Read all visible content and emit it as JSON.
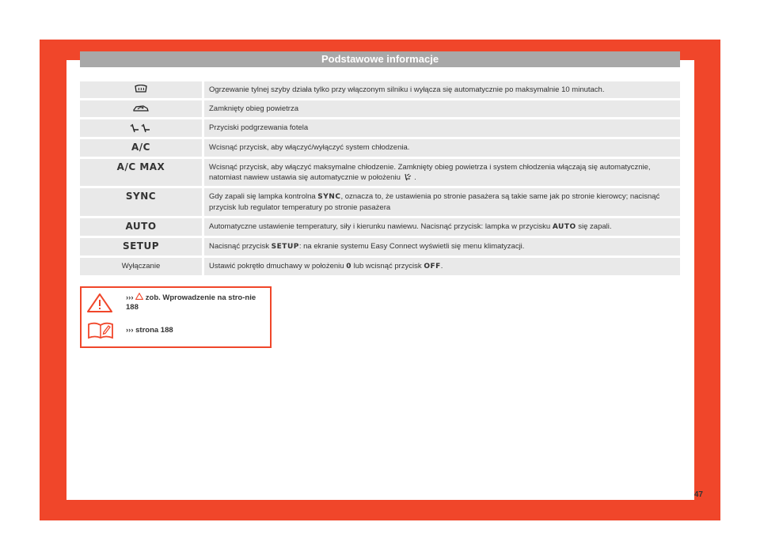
{
  "header": {
    "title": "Podstawowe informacje"
  },
  "rows": [
    {
      "icon": "rear-window-heating-icon",
      "desc": "Ogrzewanie tylnej szyby działa tylko przy włączonym silniku i wyłącza się automatycznie po maksymalnie 10 minutach."
    },
    {
      "icon": "air-recirculation-icon",
      "desc": "Zamknięty obieg powietrza"
    },
    {
      "icon": "seat-heating-icon",
      "desc": "Przyciski podgrzewania fotela"
    },
    {
      "label": "A/C",
      "desc": "Wcisnąć przycisk, aby włączyć/wyłączyć system chłodzenia."
    },
    {
      "label": "A/C MAX",
      "desc_a": "Wcisnąć przycisk, aby włączyć maksymalne chłodzenie. Zamknięty obieg powietrza i system chłodzenia włączają się automatycznie, natomiast nawiew ustawia się automatycznie w położeniu",
      "desc_b": "."
    },
    {
      "label": "SYNC",
      "desc_a": "Gdy zapali się lampka kontrolna",
      "inline": "SYNC",
      "desc_b": ", oznacza to, że ustawienia po stronie pasażera są takie same jak po stronie kierowcy; nacisnąć przycisk lub regulator temperatury po stronie pasażera"
    },
    {
      "label": "AUTO",
      "desc_a": "Automatyczne ustawienie temperatury, siły i kierunku nawiewu. Nacisnąć przycisk: lampka w przycisku",
      "inline": "AUTO",
      "desc_b": "się zapali."
    },
    {
      "label": "SETUP",
      "desc_a": "Nacisnąć przycisk",
      "inline": "SETUP",
      "desc_b": ": na ekranie systemu Easy Connect wyświetli się menu klimatyzacji."
    },
    {
      "label": "Wyłączanie",
      "desc_a": "Ustawić pokrętło dmuchawy w położeniu",
      "inline": "0",
      "desc_mid": "lub wcisnąć przycisk",
      "inline2": "OFF",
      "desc_b": "."
    }
  ],
  "notes": {
    "warning_prefix": "›››",
    "warning_text": "zob. Wprowadzenie na stro-nie 188",
    "book_text": "››› strona 188"
  },
  "page_number": "47",
  "colors": {
    "accent": "#f0462a",
    "header": "#a8a8a8",
    "row": "#e9e9e9"
  }
}
